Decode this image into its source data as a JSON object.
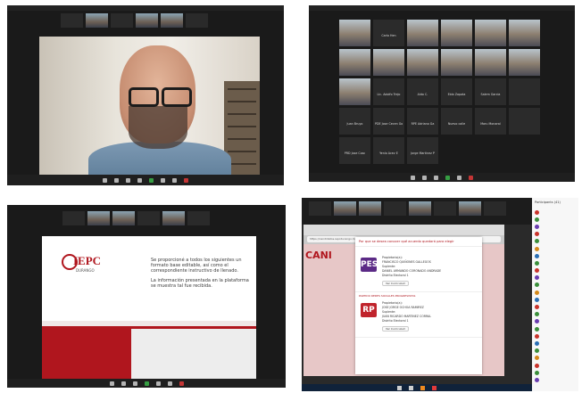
{
  "panel_tl": {
    "strip_names": [
      "",
      "",
      "",
      "",
      "",
      ""
    ],
    "shelf_count": 7
  },
  "panel_tr": {
    "gallery": [
      {
        "name": "",
        "photo": true
      },
      {
        "name": "Carlo Hen",
        "photo": false
      },
      {
        "name": "",
        "photo": true
      },
      {
        "name": "",
        "photo": true
      },
      {
        "name": "",
        "photo": true
      },
      {
        "name": "",
        "photo": true
      },
      {
        "name": "",
        "photo": true
      },
      {
        "name": "",
        "photo": true
      },
      {
        "name": "",
        "photo": true
      },
      {
        "name": "",
        "photo": true
      },
      {
        "name": "",
        "photo": true
      },
      {
        "name": "",
        "photo": true
      },
      {
        "name": "",
        "photo": true
      },
      {
        "name": "Lic. Adolfo Trejo",
        "photo": false
      },
      {
        "name": "Aldo C.",
        "photo": false
      },
      {
        "name": "Elda Zapata",
        "photo": false
      },
      {
        "name": "Salem Garcia",
        "photo": false
      },
      {
        "name": "",
        "photo": false
      },
      {
        "name": "Juan Bruyo",
        "photo": false
      },
      {
        "name": "PDE Jose Cecen Go",
        "photo": false
      },
      {
        "name": "RPE Adriano Ga",
        "photo": false
      },
      {
        "name": "Nuevo calle",
        "photo": false
      },
      {
        "name": "Maru Monaral",
        "photo": false
      },
      {
        "name": "",
        "photo": false
      },
      {
        "name": "PRD Jose Cosc",
        "photo": false
      },
      {
        "name": "Yenlo Acev E",
        "photo": false
      },
      {
        "name": "Jorge Martinez P",
        "photo": false
      }
    ]
  },
  "panel_bl": {
    "logo_title": "IEPC",
    "logo_sub": "DURANGO",
    "para1": "Se proporcioné a todos los siguientes un formato base editable, así como el correspondiente instructivo de llenado.",
    "para2": "La información presentada en la plataforma se muestra tal fue recibida."
  },
  "panel_br": {
    "page_heading": "CANI",
    "address": "https://candidatos.iepcdurango.mx",
    "modal_title": "Por que se desea conocer qué acuerdo quedará para elegir",
    "entries": [
      {
        "header": "",
        "badge": "PES",
        "badge_color": "#5b2a86",
        "lines": [
          "Propietario(a):",
          "FRANCISCO QUIÑONES GALLEGOS",
          "Suplente:",
          "DANIEL ARMANDO CORONADO ANDRADE",
          "Distrito Electoral 1"
        ],
        "btn": "Ver Curriculum"
      },
      {
        "header": "PARTIDO REDES SOCIALES PROGRESISTAS",
        "badge": "RP",
        "badge_color": "#c0242c",
        "lines": [
          "Propietario(a):",
          "JOSE JORGE OCHOA RAMIREZ",
          "Suplente:",
          "JUAN RICARDO MARTINEZ CORRAL",
          "Distrito Electoral 1"
        ],
        "btn": "Ver Curriculum"
      }
    ],
    "participants_title": "Participants (41)",
    "participants": [
      "",
      "",
      "",
      "",
      "",
      "",
      "",
      "",
      "",
      "",
      "",
      "",
      "",
      "",
      "",
      "",
      "",
      "",
      "",
      "",
      "",
      "",
      "",
      ""
    ],
    "participant_colors": [
      "#c9342c",
      "#3b8f3b",
      "#6a3db0",
      "#c9342c",
      "#3b8f3b",
      "#d48a1c",
      "#2a6fb5",
      "#3b8f3b",
      "#c9342c",
      "#6a3db0",
      "#3b8f3b",
      "#d48a1c",
      "#2a6fb5",
      "#c9342c",
      "#3b8f3b",
      "#6a3db0",
      "#3b8f3b",
      "#c9342c",
      "#2a6fb5",
      "#3b8f3b",
      "#d48a1c",
      "#c9342c",
      "#3b8f3b",
      "#6a3db0"
    ]
  }
}
